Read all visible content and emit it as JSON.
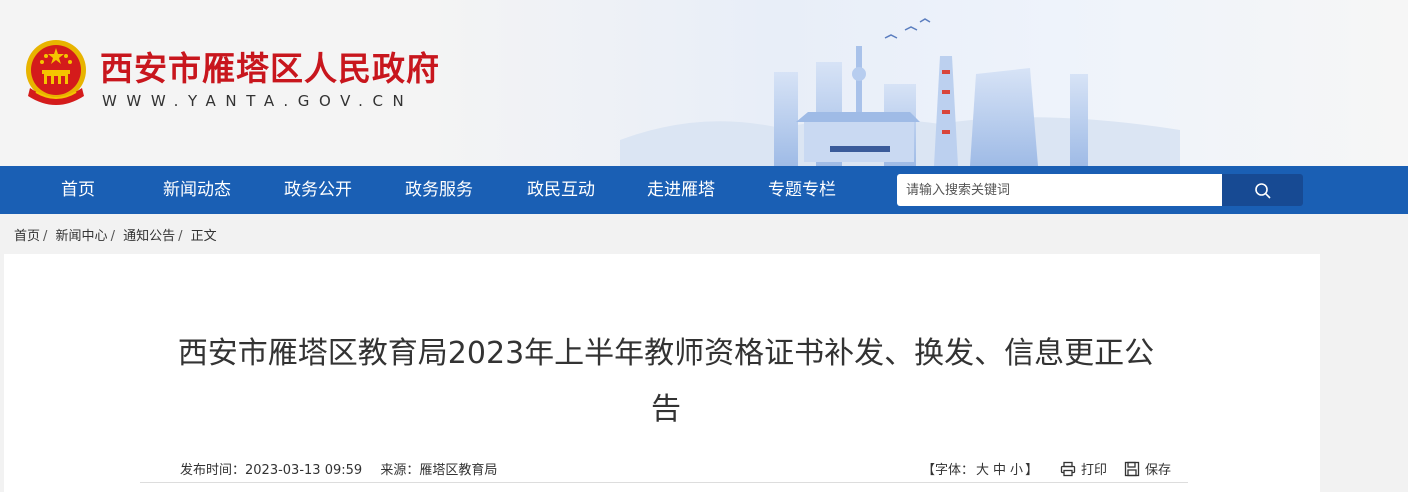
{
  "site": {
    "title": "西安市雁塔区人民政府",
    "url": "WWW.YANTA.GOV.CN",
    "brand_color": "#c8161d"
  },
  "nav": {
    "items": [
      {
        "label": "首页"
      },
      {
        "label": "新闻动态"
      },
      {
        "label": "政务公开"
      },
      {
        "label": "政务服务"
      },
      {
        "label": "政民互动"
      },
      {
        "label": "走进雁塔"
      },
      {
        "label": "专题专栏"
      }
    ],
    "search_placeholder": "请输入搜索关键词",
    "bar_color": "#1a5fb4"
  },
  "breadcrumb": {
    "items": [
      "首页",
      "新闻中心",
      "通知公告",
      "正文"
    ],
    "separator": "/"
  },
  "article": {
    "title_line1": "西安市雁塔区教育局2023年上半年教师资格证书补发、换发、信息更正公",
    "title_line2": "告",
    "publish_label": "发布时间：",
    "publish_time": "2023-03-13 09:59",
    "source_label": "来源：",
    "source": "雁塔区教育局",
    "font_size_label": "【字体：",
    "font_large": "大",
    "font_medium": "中",
    "font_small": "小",
    "font_close": "】",
    "print_label": "打印",
    "save_label": "保存"
  },
  "icons": {
    "emblem": "national-emblem-icon",
    "search": "search-icon",
    "print": "print-icon",
    "save": "save-icon"
  }
}
